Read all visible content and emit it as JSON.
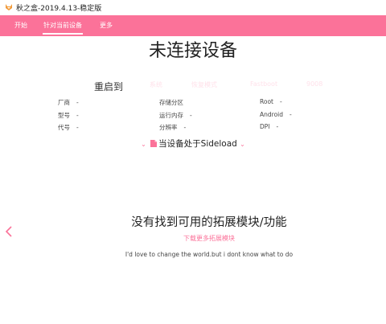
{
  "window": {
    "title": "秋之盒-2019.4.13-稳定版",
    "app_icon": "fox-logo-icon"
  },
  "nav": {
    "tabs": [
      {
        "label": "开始"
      },
      {
        "label": "针对当前设备",
        "active": true
      },
      {
        "label": "更多"
      }
    ],
    "accent_color": "#fb7299"
  },
  "device": {
    "status": "未连接设备"
  },
  "reboot": {
    "label": "重启到",
    "options": [
      "系统",
      "恢复模式",
      "Fastboot",
      "9008"
    ]
  },
  "info": {
    "col1": [
      {
        "label": "厂商",
        "value": "-"
      },
      {
        "label": "型号",
        "value": "-"
      },
      {
        "label": "代号",
        "value": "-"
      }
    ],
    "col2": [
      {
        "label": "存储分区",
        "value": ""
      },
      {
        "label": "运行内存",
        "value": "-"
      },
      {
        "label": "分辨率",
        "value": "-"
      }
    ],
    "col3": [
      {
        "label": "Root",
        "value": "-"
      },
      {
        "label": "Android",
        "value": "-"
      },
      {
        "label": "DPI",
        "value": "-"
      }
    ]
  },
  "sideload": {
    "text": "当设备处于Sideload",
    "icon": "file-icon"
  },
  "extensions": {
    "empty_title": "没有找到可用的拓展模块/功能",
    "download_link": "下载更多拓展模块",
    "tagline": "I'd love to change the world.but i dont know what to do"
  }
}
